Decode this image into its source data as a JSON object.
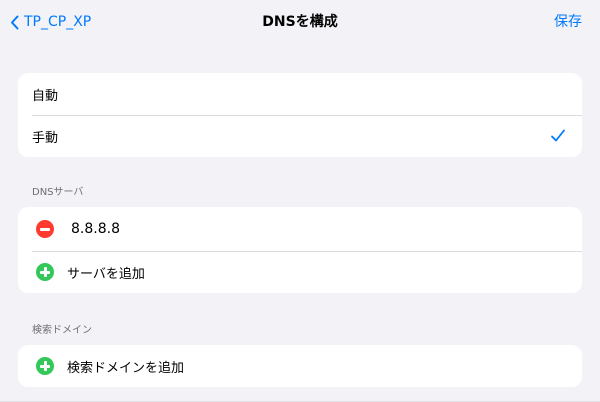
{
  "nav": {
    "back_label": "TP_CP_XP",
    "title": "DNSを構成",
    "save_label": "保存"
  },
  "mode": {
    "options": [
      {
        "label": "自動",
        "selected": false
      },
      {
        "label": "手動",
        "selected": true
      }
    ]
  },
  "dns_servers": {
    "header": "DNSサーバ",
    "servers": [
      "8.8.8.8"
    ],
    "add_label": "サーバを追加"
  },
  "search_domains": {
    "header": "検索ドメイン",
    "add_label": "検索ドメインを追加"
  },
  "colors": {
    "accent": "#007aff",
    "delete": "#ff3b30",
    "add": "#34c759",
    "background": "#f2f2f7"
  },
  "icons": {
    "back": "chevron-left-icon",
    "selected": "checkmark-icon",
    "delete": "minus-circle-icon",
    "add": "plus-circle-icon"
  }
}
